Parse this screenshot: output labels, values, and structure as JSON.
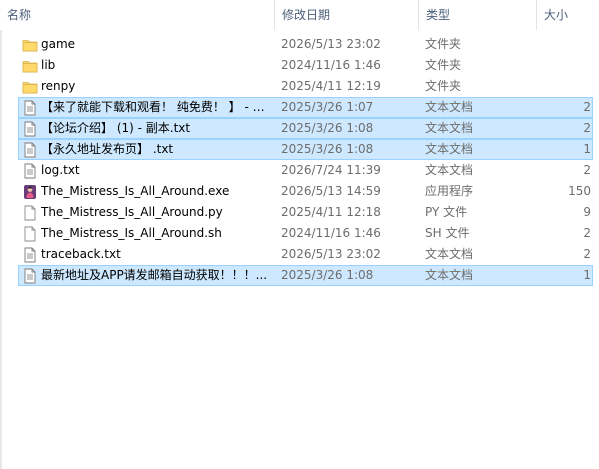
{
  "columns": {
    "name": "名称",
    "date": "修改日期",
    "type": "类型",
    "size": "大小"
  },
  "sort_indicator": "^",
  "files": [
    {
      "name": "game",
      "date": "2026/5/13 23:02",
      "type": "文件夹",
      "size": "",
      "icon": "folder-icon",
      "selected": false
    },
    {
      "name": "lib",
      "date": "2024/11/16 1:46",
      "type": "文件夹",
      "size": "",
      "icon": "folder-icon",
      "selected": false
    },
    {
      "name": "renpy",
      "date": "2025/4/11 12:19",
      "type": "文件夹",
      "size": "",
      "icon": "folder-icon",
      "selected": false
    },
    {
      "name": "【来了就能下载和观看！ 纯免费！ 】 - 副...",
      "date": "2025/3/26 1:07",
      "type": "文本文档",
      "size": "2",
      "icon": "text-file-icon",
      "selected": true
    },
    {
      "name": "【论坛介绍】 (1) - 副本.txt",
      "date": "2025/3/26 1:08",
      "type": "文本文档",
      "size": "2",
      "icon": "text-file-icon",
      "selected": true
    },
    {
      "name": "【永久地址发布页】 .txt",
      "date": "2025/3/26 1:08",
      "type": "文本文档",
      "size": "1",
      "icon": "text-file-icon",
      "selected": true
    },
    {
      "name": "log.txt",
      "date": "2026/7/24 11:39",
      "type": "文本文档",
      "size": "2",
      "icon": "text-file-icon",
      "selected": false
    },
    {
      "name": "The_Mistress_Is_All_Around.exe",
      "date": "2026/5/13 14:59",
      "type": "应用程序",
      "size": "150",
      "icon": "app-icon",
      "selected": false
    },
    {
      "name": "The_Mistress_Is_All_Around.py",
      "date": "2025/4/11 12:18",
      "type": "PY 文件",
      "size": "9",
      "icon": "blank-file-icon",
      "selected": false
    },
    {
      "name": "The_Mistress_Is_All_Around.sh",
      "date": "2024/11/16 1:46",
      "type": "SH 文件",
      "size": "2",
      "icon": "blank-file-icon",
      "selected": false
    },
    {
      "name": "traceback.txt",
      "date": "2026/5/13 23:02",
      "type": "文本文档",
      "size": "2",
      "icon": "text-file-icon",
      "selected": false
    },
    {
      "name": "最新地址及APP请发邮箱自动获取！！！...",
      "date": "2025/3/26 1:08",
      "type": "文本文档",
      "size": "1",
      "icon": "text-file-icon",
      "selected": true
    }
  ],
  "colors": {
    "selection_fill": "#cde8ff",
    "selection_border": "#99d1ff",
    "folder": "#f8d775",
    "header_text": "#4c607a",
    "secondary_text": "#6d6d6d"
  }
}
